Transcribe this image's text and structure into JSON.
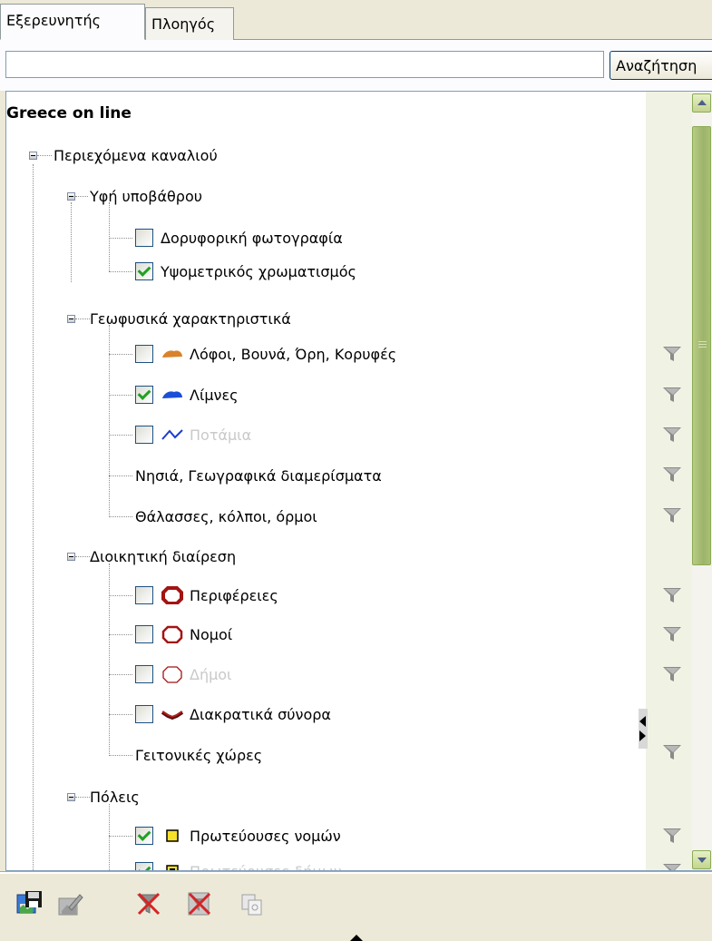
{
  "tabs": [
    {
      "label": "Εξερευνητής",
      "active": true
    },
    {
      "label": "Πλοηγός",
      "active": false
    }
  ],
  "search": {
    "value": "",
    "placeholder": "",
    "button_label": "Αναζήτηση"
  },
  "tree": {
    "root_title": "Greece on line",
    "items": [
      {
        "label": "Περιεχόμενα καναλιού",
        "type": "group"
      },
      {
        "label": "Υφή υποβάθρου",
        "type": "group"
      },
      {
        "label": "Δορυφορική φωτογραφία",
        "checked": false
      },
      {
        "label": "Υψομετρικός χρωματισμός",
        "checked": true
      },
      {
        "label": "Γεωφυσικά χαρακτηριστικά",
        "type": "group"
      },
      {
        "label": "Λόφοι, Βουνά, Όρη, Κορυφές",
        "checked": false,
        "icon": "mountain-icon",
        "filter": true
      },
      {
        "label": "Λίμνες",
        "checked": true,
        "icon": "lake-icon",
        "filter": true
      },
      {
        "label": "Ποτάμια",
        "checked": false,
        "icon": "river-icon",
        "filter": true,
        "dimmed": true
      },
      {
        "label": "Νησιά, Γεωγραφικά διαμερίσματα",
        "filter": true
      },
      {
        "label": "Θάλασσες, κόλποι, όρμοι",
        "filter": true
      },
      {
        "label": "Διοικητική διαίρεση",
        "type": "group"
      },
      {
        "label": "Περιφέρειες",
        "checked": false,
        "icon": "region-octagon-icon",
        "filter": true
      },
      {
        "label": "Νομοί",
        "checked": false,
        "icon": "prefecture-octagon-icon",
        "filter": true
      },
      {
        "label": "Δήμοι",
        "checked": false,
        "icon": "municipality-octagon-icon",
        "filter": true,
        "dimmed": true
      },
      {
        "label": "Διακρατικά σύνορα",
        "checked": false,
        "icon": "border-line-icon"
      },
      {
        "label": "Γειτονικές χώρες",
        "filter": true
      },
      {
        "label": "Πόλεις",
        "type": "group"
      },
      {
        "label": "Πρωτεύουσες νομών",
        "checked": true,
        "icon": "yellow-square-icon",
        "filter": true
      },
      {
        "label": "Πρωτεύουσες δήμων",
        "checked": true,
        "icon": "black-square-icon",
        "filter": true,
        "dimmed": true
      }
    ]
  },
  "toolbar": {
    "buttons": [
      "save-map-icon",
      "edit-map-icon",
      "clear-filter-icon",
      "remove-filter-icon",
      "copy-icon"
    ]
  },
  "colors": {
    "mountain": "#d9822b",
    "lake": "#1c4fd6",
    "river": "#1c3ccf",
    "octagon": "#a31414",
    "yellow_square": "#f5e02a",
    "check_green": "#21a121"
  }
}
